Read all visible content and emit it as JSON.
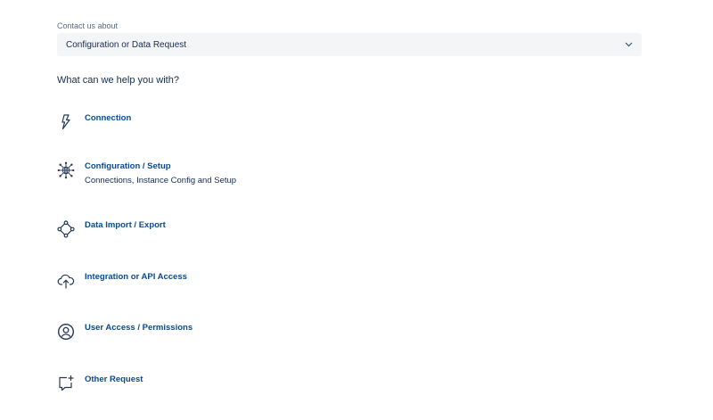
{
  "contact": {
    "label": "Contact us about",
    "selected": "Configuration or Data Request"
  },
  "section_title": "What can we help you with?",
  "options": [
    {
      "title": "Connection",
      "description": "",
      "icon": "lightning-icon"
    },
    {
      "title": "Configuration / Setup",
      "description": "Connections, Instance Config and Setup",
      "icon": "network-hub-icon"
    },
    {
      "title": "Data Import / Export",
      "description": "",
      "icon": "diamond-nodes-icon"
    },
    {
      "title": "Integration or API Access",
      "description": "",
      "icon": "cloud-upload-icon"
    },
    {
      "title": "User Access / Permissions",
      "description": "",
      "icon": "user-circle-icon"
    },
    {
      "title": "Other Request",
      "description": "",
      "icon": "chat-plus-icon"
    }
  ],
  "colors": {
    "link": "#0b4a8c",
    "text": "#172b4d",
    "muted": "#5e6c84",
    "select_bg": "#f4f5f7"
  }
}
